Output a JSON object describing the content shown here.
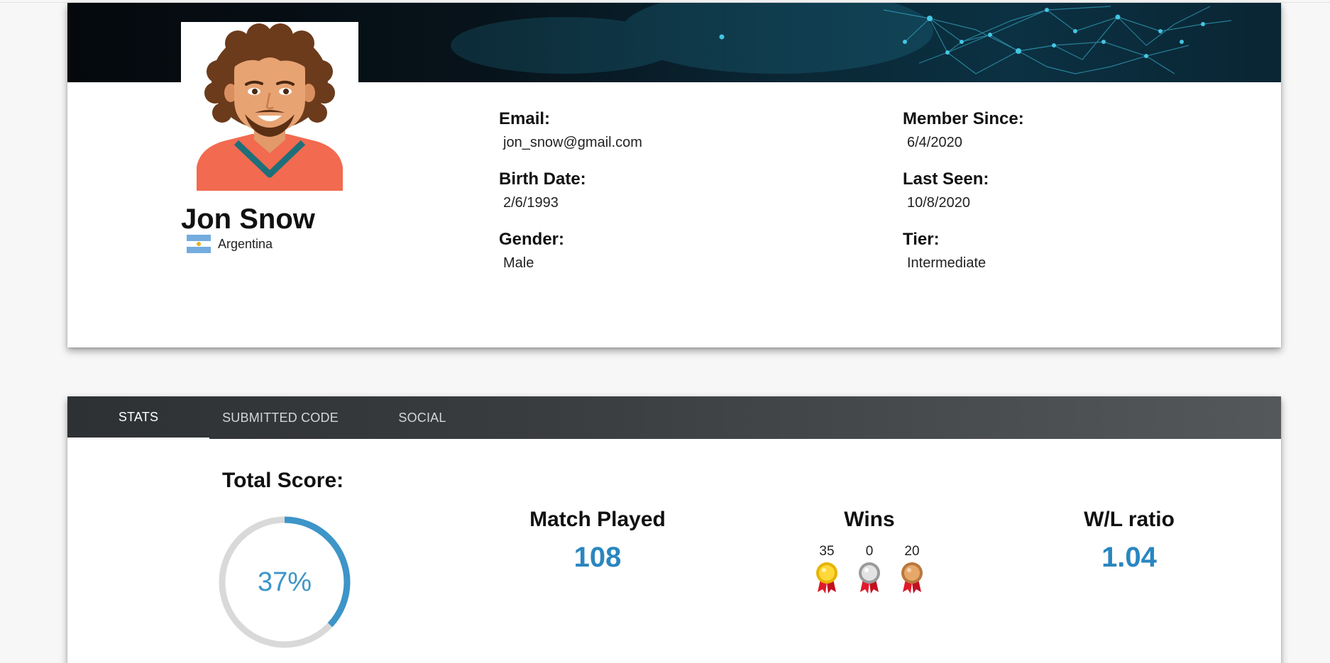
{
  "profile": {
    "name": "Jon Snow",
    "country": "Argentina",
    "fields": {
      "email": {
        "label": "Email:",
        "value": "jon_snow@gmail.com"
      },
      "birth_date": {
        "label": "Birth Date:",
        "value": "2/6/1993"
      },
      "gender": {
        "label": "Gender:",
        "value": "Male"
      },
      "member_since": {
        "label": "Member Since:",
        "value": "6/4/2020"
      },
      "last_seen": {
        "label": "Last Seen:",
        "value": "10/8/2020"
      },
      "tier": {
        "label": "Tier:",
        "value": "Intermediate"
      }
    }
  },
  "tabs": [
    {
      "label": "STATS",
      "active": true
    },
    {
      "label": "SUBMITTED CODE",
      "active": false
    },
    {
      "label": "SOCIAL",
      "active": false
    }
  ],
  "stats": {
    "total_score_label": "Total Score:",
    "total_score_value": "37%",
    "total_score_fraction": 0.37,
    "match_played_label": "Match Played",
    "match_played_value": "108",
    "wins_label": "Wins",
    "wins": {
      "gold": "35",
      "silver": "0",
      "bronze": "20"
    },
    "wl_ratio_label": "W/L ratio",
    "wl_ratio_value": "1.04"
  },
  "colors": {
    "accent": "#3d95c8",
    "value_blue": "#2a86c0",
    "ring_track": "#d9d9d9",
    "tab_bar": "#3a3d40"
  },
  "icons": [
    "avatar",
    "argentina-flag-icon",
    "gold-medal-icon",
    "silver-medal-icon",
    "bronze-medal-icon"
  ]
}
